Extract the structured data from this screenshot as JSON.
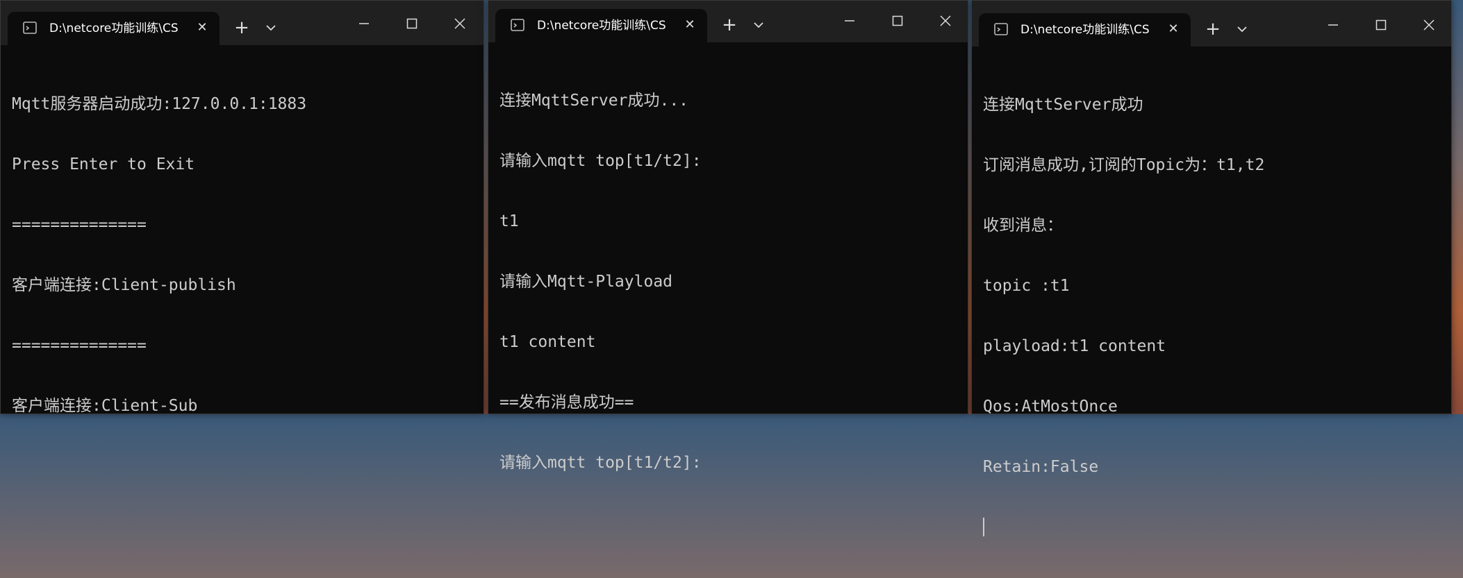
{
  "windows": [
    {
      "tab_title": "D:\\netcore功能训练\\CS",
      "lines": [
        "Mqtt服务器启动成功:127.0.0.1:1883",
        "Press Enter to Exit",
        "==============",
        "客户端连接:Client-publish",
        "==============",
        "客户端连接:Client-Sub"
      ]
    },
    {
      "tab_title": "D:\\netcore功能训练\\CS",
      "lines": [
        "连接MqttServer成功...",
        "请输入mqtt top[t1/t2]:",
        "t1",
        "请输入Mqtt-Playload",
        "t1 content",
        "==发布消息成功==",
        "请输入mqtt top[t1/t2]:"
      ]
    },
    {
      "tab_title": "D:\\netcore功能训练\\CS",
      "lines": [
        "连接MqttServer成功",
        "订阅消息成功,订阅的Topic为：t1,t2",
        "收到消息：",
        "topic :t1",
        "playload:t1 content",
        "Qos:AtMostOnce",
        "Retain:False"
      ]
    }
  ],
  "icons": {
    "terminal": "terminal-icon",
    "close": "close-icon",
    "new_tab": "plus-icon",
    "dropdown": "chevron-down-icon",
    "minimize": "minimize-icon",
    "maximize": "maximize-icon",
    "window_close": "window-close-icon"
  },
  "glyphs": {
    "close": "✕",
    "plus": "+"
  },
  "colors": {
    "terminal_bg": "#0c0c0c",
    "titlebar_bg": "#202020",
    "text": "#cccccc"
  }
}
